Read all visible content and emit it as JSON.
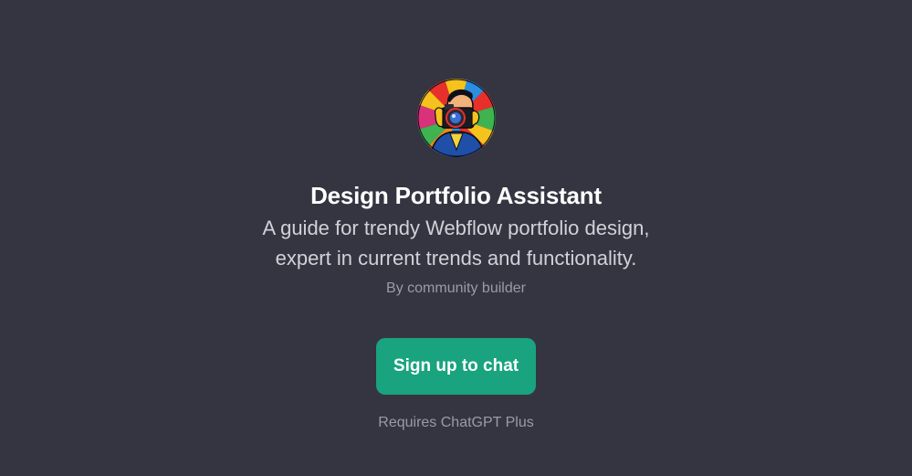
{
  "profile": {
    "avatar_icon": "photographer-camera-avatar",
    "title": "Design Portfolio Assistant",
    "description_lines": [
      "A guide for trendy Webflow portfolio design,",
      "expert in current trends and functionality."
    ],
    "author": "By community builder"
  },
  "cta": {
    "label": "Sign up to chat",
    "color": "#19a37f"
  },
  "footer": {
    "note": "Requires ChatGPT Plus"
  },
  "theme": {
    "background": "#343541"
  }
}
